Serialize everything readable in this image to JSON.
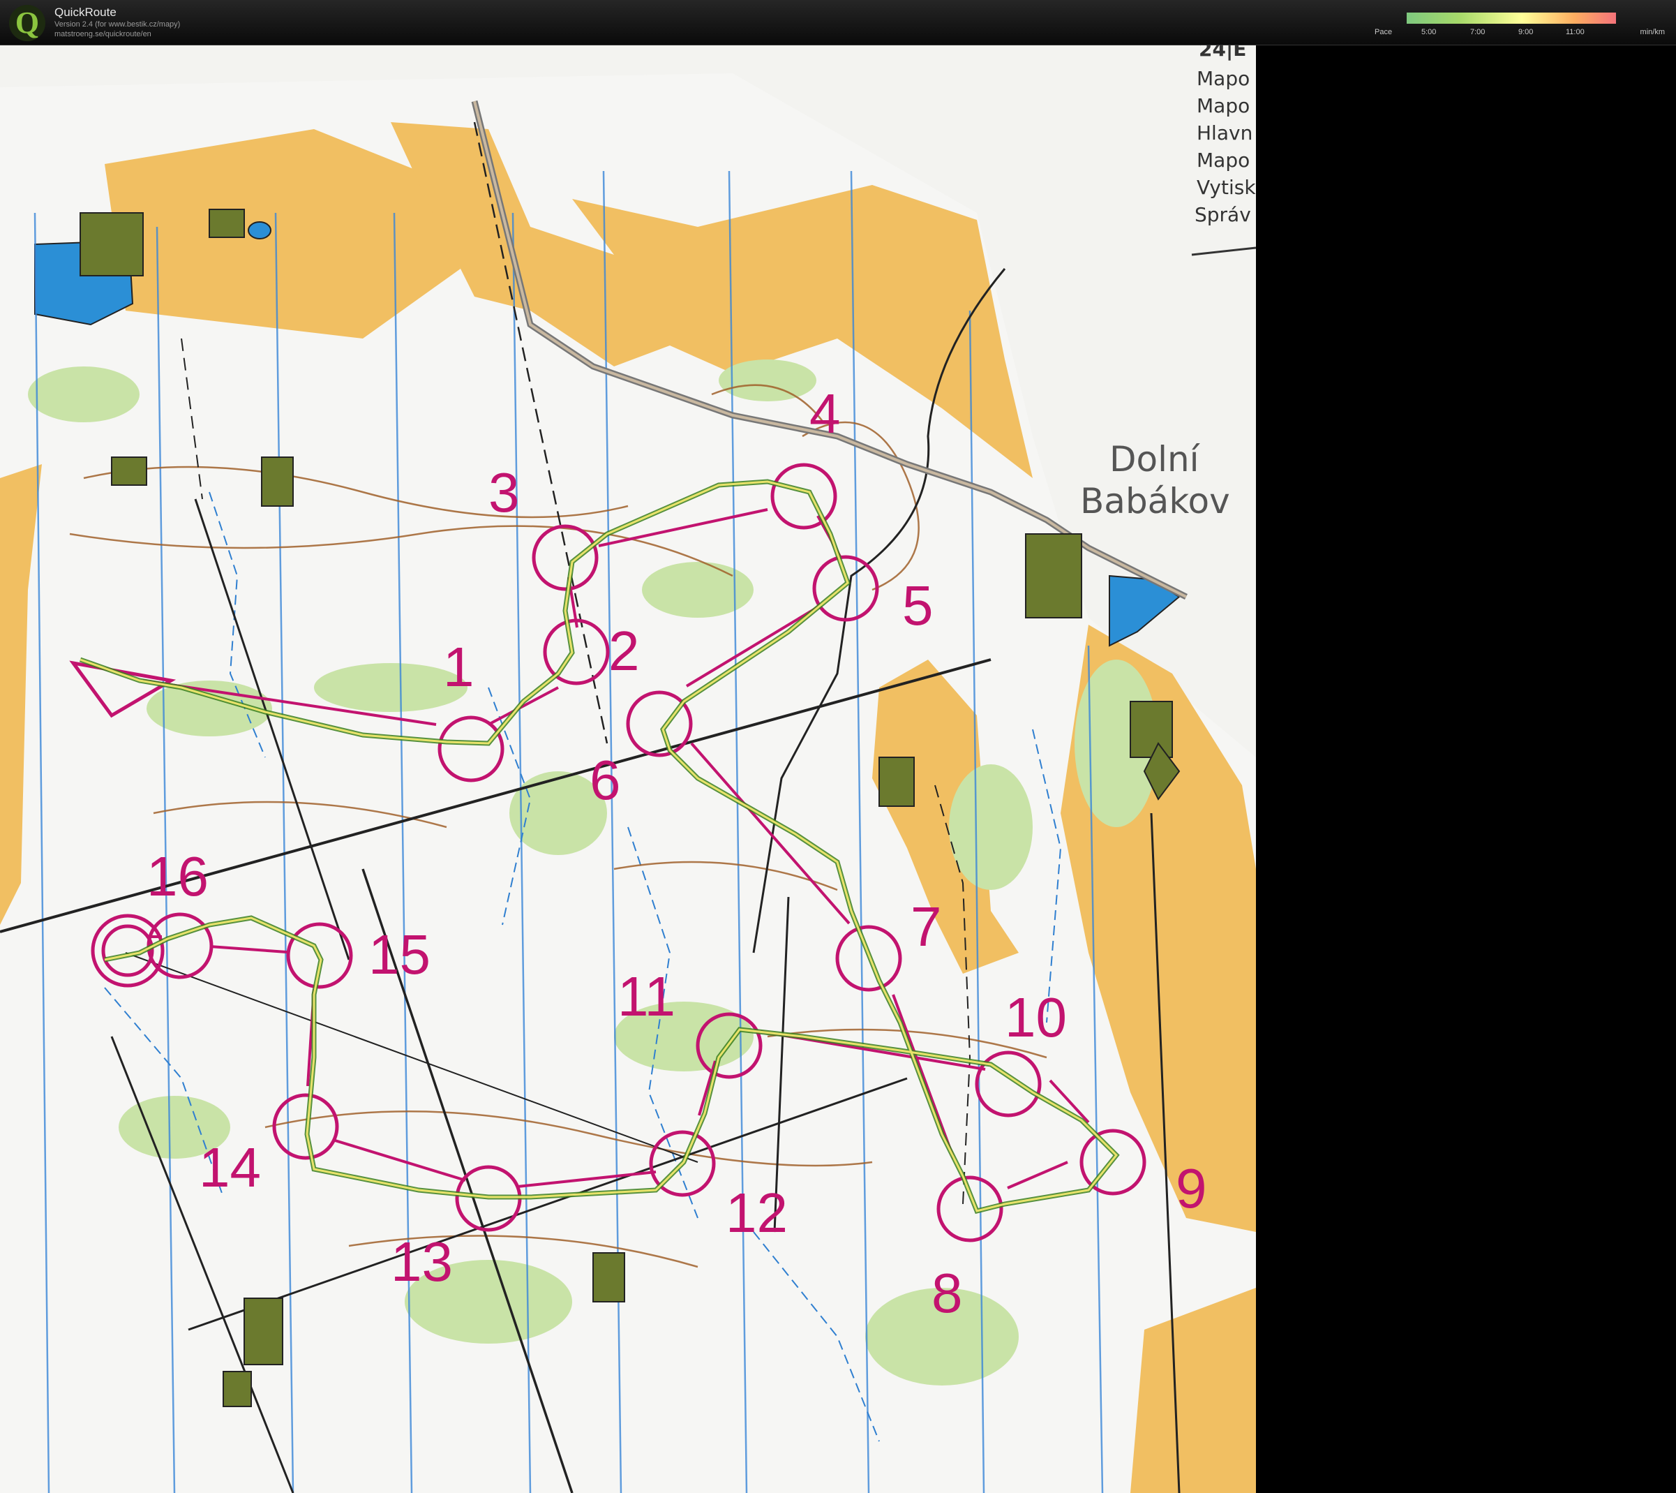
{
  "header": {
    "app_title": "QuickRoute",
    "version_line": "Version 2.4  (for www.bestik.cz/mapy)",
    "url_line": "matstroeng.se/quickroute/en",
    "logo_letter": "Q"
  },
  "pace_legend": {
    "label": "Pace",
    "unit": "min/km",
    "ticks": [
      "5:00",
      "7:00",
      "9:00",
      "11:00"
    ],
    "colors": [
      "#7fc97f",
      "#a6d96a",
      "#ffff99",
      "#fdae61",
      "#f4737a"
    ]
  },
  "map": {
    "town_name_line1": "Dolní",
    "town_name_line2": "Babákov",
    "margin_text": [
      "24|E",
      "Mapo",
      "Mapo",
      "Hlavn",
      "Mapo",
      "Vytisk",
      "Správ"
    ],
    "controls": [
      "1",
      "2",
      "3",
      "4",
      "5",
      "6",
      "7",
      "8",
      "9",
      "10",
      "11",
      "12",
      "13",
      "14",
      "15",
      "16"
    ],
    "course_color": "#c2136f",
    "route_color": "#d8d850"
  }
}
